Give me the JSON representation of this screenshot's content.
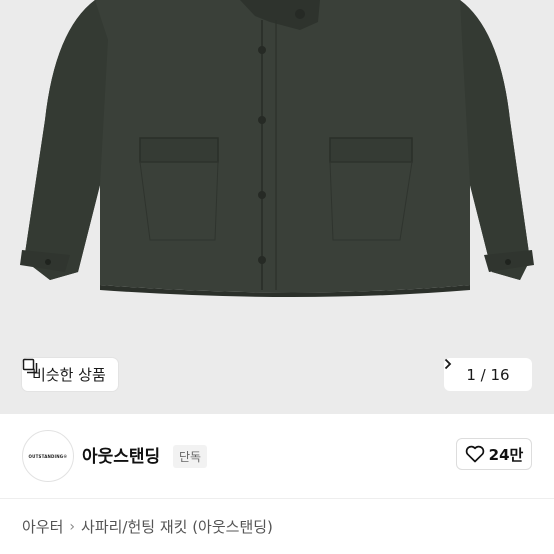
{
  "product_image": {
    "similar_label": "비슷한 상품",
    "counter": "1 / 16"
  },
  "brand": {
    "logo_text": "OUTSTANDING®",
    "name": "아웃스탠딩",
    "badge": "단독"
  },
  "like": {
    "count": "24만"
  },
  "breadcrumb": {
    "items": [
      "아우터",
      "사파리/헌팅 재킷 (아웃스탠딩)"
    ]
  },
  "colors": {
    "jacket": "#3a4039",
    "background": "#ebebeb"
  }
}
